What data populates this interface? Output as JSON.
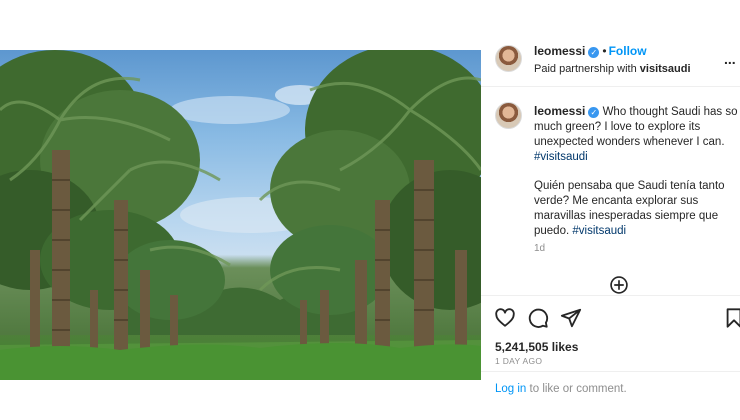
{
  "post": {
    "username": "leomessi",
    "follow_label": "Follow",
    "separator": "•",
    "more_label": "...",
    "partnership_prefix": "Paid partnership with",
    "partner": "visitsaudi"
  },
  "caption": {
    "username": "leomessi",
    "text_en": "Who thought Saudi has so much green? I love to explore its unexpected wonders whenever I can.",
    "hashtag_en": "#visitsaudi",
    "text_es": "Quién pensaba que Saudi tenía tanto verde? Me encanta explorar sus maravillas inesperadas siempre que puedo.",
    "hashtag_es": "#visitsaudi",
    "time": "1d"
  },
  "engagement": {
    "likes": "5,241,505 likes",
    "posted": "1 DAY AGO"
  },
  "footer": {
    "login_link": "Log in",
    "login_rest": " to like or comment."
  },
  "icons": [
    "heart-icon",
    "comment-icon",
    "share-icon",
    "bookmark-icon",
    "add-circle-icon",
    "verified-badge-icon"
  ],
  "colors": {
    "link_blue": "#0095f6",
    "hashtag": "#00376b",
    "muted": "#8e8e8e",
    "verified": "#3897f0"
  }
}
